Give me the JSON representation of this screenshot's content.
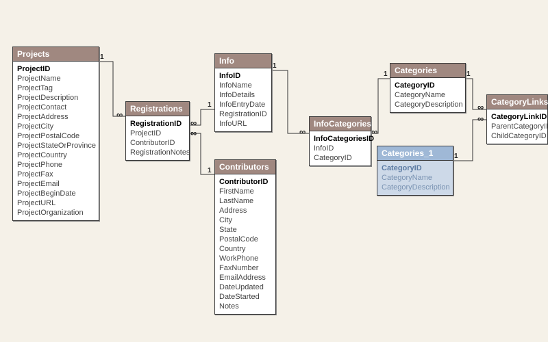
{
  "tables": {
    "projects": {
      "title": "Projects",
      "fields": [
        "ProjectID",
        "ProjectName",
        "ProjectTag",
        "ProjectDescription",
        "ProjectContact",
        "ProjectAddress",
        "ProjectCity",
        "ProjectPostalCode",
        "ProjectStateOrProvince",
        "ProjectCountry",
        "ProjectPhone",
        "ProjectFax",
        "ProjectEmail",
        "ProjectBeginDate",
        "ProjectURL",
        "ProjectOrganization"
      ],
      "pk": "ProjectID"
    },
    "registrations": {
      "title": "Registrations",
      "fields": [
        "RegistrationID",
        "ProjectID",
        "ContributorID",
        "RegistrationNotes"
      ],
      "pk": "RegistrationID"
    },
    "info": {
      "title": "Info",
      "fields": [
        "InfoID",
        "InfoName",
        "InfoDetails",
        "InfoEntryDate",
        "RegistrationID",
        "InfoURL"
      ],
      "pk": "InfoID"
    },
    "contributors": {
      "title": "Contributors",
      "fields": [
        "ContributorID",
        "FirstName",
        "LastName",
        "Address",
        "City",
        "State",
        "PostalCode",
        "Country",
        "WorkPhone",
        "FaxNumber",
        "EmailAddress",
        "DateUpdated",
        "DateStarted",
        "Notes"
      ],
      "pk": "ContributorID"
    },
    "infoCategories": {
      "title": "InfoCategories",
      "fields": [
        "InfoCategoriesID",
        "InfoID",
        "CategoryID"
      ],
      "pk": "InfoCategoriesID"
    },
    "categories": {
      "title": "Categories",
      "fields": [
        "CategoryID",
        "CategoryName",
        "CategoryDescription"
      ],
      "pk": "CategoryID"
    },
    "categories1": {
      "title": "Categories_1",
      "fields": [
        "CategoryID",
        "CategoryName",
        "CategoryDescription"
      ],
      "pk": "CategoryID"
    },
    "categoryLinks": {
      "title": "CategoryLinks",
      "fields": [
        "CategoryLinkID",
        "ParentCategoryID",
        "ChildCategoryID"
      ],
      "pk": "CategoryLinkID"
    }
  },
  "cardinality": {
    "one": "1",
    "many": "∞"
  }
}
